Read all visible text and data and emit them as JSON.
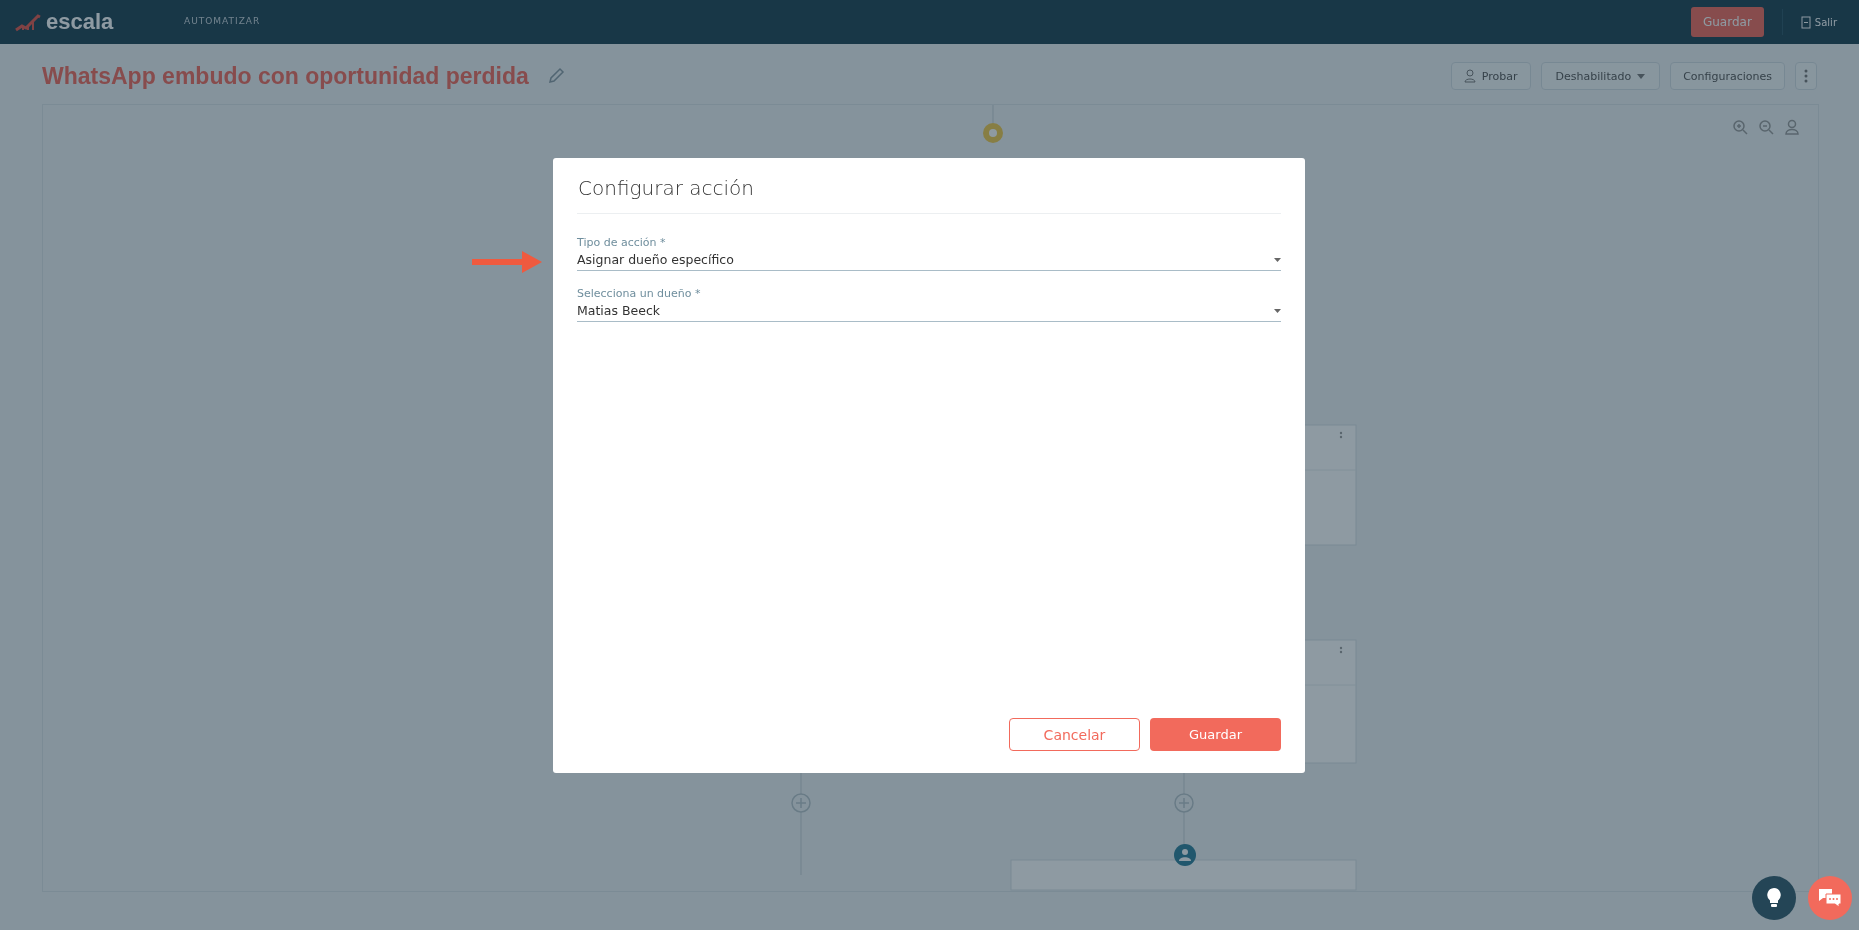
{
  "header": {
    "logo": "escala",
    "nav": [
      {
        "label": "AUTOMATIZAR"
      }
    ],
    "save_button": "Guardar",
    "exit": "Salir"
  },
  "page": {
    "title": "WhatsApp embudo con oportunidad perdida",
    "actions": [
      {
        "kind": "user",
        "label": "Probar"
      },
      {
        "kind": "dropdown",
        "label": "Deshabilitado"
      },
      {
        "kind": "plain",
        "label": "Configuraciones"
      },
      {
        "kind": "menu"
      }
    ]
  },
  "dialog": {
    "title": "Configurar acción",
    "fields": [
      {
        "label": "Tipo de acción *",
        "value": "Asignar dueño específico"
      },
      {
        "label": "Selecciona un dueño *",
        "value": "Matias Beeck"
      }
    ],
    "buttons": [
      {
        "kind": "secondary",
        "label": "Cancelar"
      },
      {
        "kind": "primary",
        "label": "Guardar"
      }
    ]
  }
}
